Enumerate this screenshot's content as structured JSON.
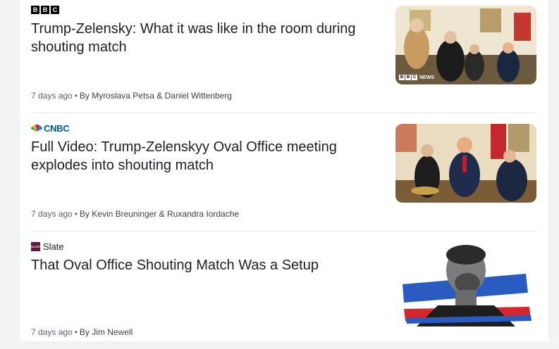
{
  "articles": [
    {
      "source": {
        "name": "BBC",
        "logo_letters": [
          "B",
          "B",
          "C"
        ]
      },
      "headline": "Trump-Zelensky: What it was like in the room during shouting match",
      "time": "7 days ago",
      "byline": "By Myroslava Petsa & Daniel Wittenberg",
      "thumbnail": {
        "watermark": "NEWS"
      }
    },
    {
      "source": {
        "name": "CNBC"
      },
      "headline": "Full Video: Trump-Zelenskyy Oval Office meeting explodes into shouting match",
      "time": "7 days ago",
      "byline": "By Kevin Breuninger & Ruxandra Iordache"
    },
    {
      "source": {
        "name": "Slate",
        "logo_text": "SLATE"
      },
      "headline": "That Oval Office Shouting Match Was a Setup",
      "time": "7 days ago",
      "byline": "By Jim Newell"
    }
  ],
  "separator": "•",
  "colors": {
    "cnbc_blue": "#005594",
    "slate_purple": "#5c1c3c",
    "flag_red": "#d7262e",
    "flag_blue": "#2a5bc0"
  }
}
